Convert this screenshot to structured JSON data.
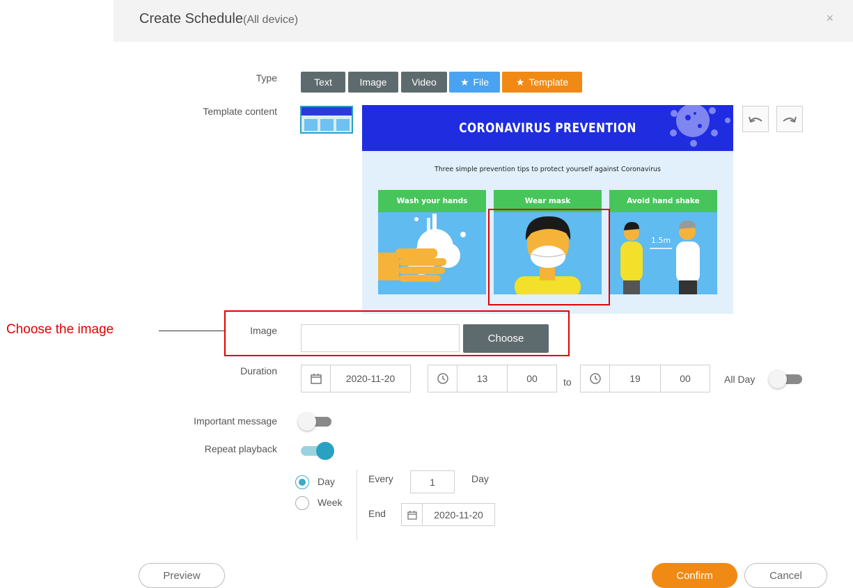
{
  "dialog": {
    "title": "Create Schedule",
    "title_suffix": "(All device)",
    "close_glyph": "×"
  },
  "type": {
    "label": "Type",
    "options": [
      {
        "label": "Text",
        "star": false
      },
      {
        "label": "Image",
        "star": false
      },
      {
        "label": "Video",
        "star": false
      },
      {
        "label": "File",
        "star": true
      },
      {
        "label": "Template",
        "star": true
      }
    ],
    "selected": "Template",
    "star_glyph": "★"
  },
  "template_content": {
    "label": "Template content",
    "preview": {
      "title": "CORONAVIRUS PREVENTION",
      "subtitle": "Three simple prevention tips to protect yourself against Coronavirus",
      "panels": [
        {
          "heading": "Wash your hands"
        },
        {
          "heading": "Wear mask"
        },
        {
          "heading": "Avoid hand shake",
          "distance": "1.5m"
        }
      ]
    }
  },
  "image": {
    "label": "Image",
    "value": "",
    "choose_label": "Choose"
  },
  "annotation": {
    "text": "Choose the image"
  },
  "duration": {
    "label": "Duration",
    "date": "2020-11-20",
    "start_hour": "13",
    "start_min": "00",
    "to_label": "to",
    "end_hour": "19",
    "end_min": "00",
    "all_day_label": "All Day",
    "all_day": false
  },
  "important_message": {
    "label": "Important message",
    "enabled": false
  },
  "repeat_playback": {
    "label": "Repeat playback",
    "enabled": true,
    "mode_options": [
      "Day",
      "Week"
    ],
    "selected_mode": "Day",
    "every_label": "Every",
    "every_value": "1",
    "every_unit": "Day",
    "end_label": "End",
    "end_date": "2020-11-20"
  },
  "footer": {
    "preview_label": "Preview",
    "confirm_label": "Confirm",
    "cancel_label": "Cancel"
  },
  "colors": {
    "accent_orange": "#f08a14",
    "type_dark": "#5e6b6e",
    "file_blue": "#4aa3f0",
    "toggle_teal": "#2aa1c0",
    "annotation_red": "#e00000"
  }
}
